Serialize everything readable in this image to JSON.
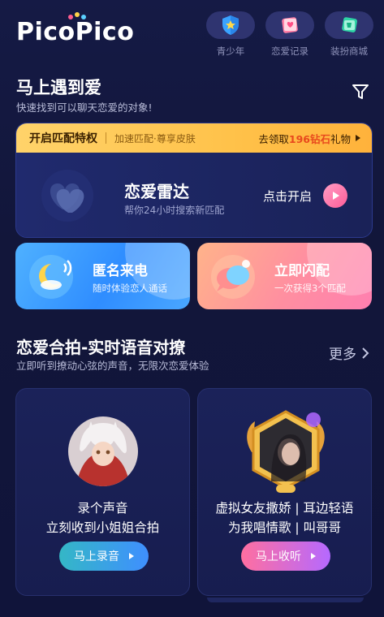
{
  "header": {
    "logo": "PicoPico",
    "nav": [
      {
        "label": "青少年",
        "icon": "shield-star-icon"
      },
      {
        "label": "恋爱记录",
        "icon": "love-record-icon"
      },
      {
        "label": "装扮商城",
        "icon": "dress-up-store-icon"
      }
    ]
  },
  "match": {
    "title": "马上遇到爱",
    "subtitle": "快速找到可以聊天恋爱的对象!",
    "banner": {
      "title": "开启匹配特权",
      "desc": "加速匹配·尊享皮肤",
      "reward_prefix": "去领取",
      "reward_highlight": "196钻石",
      "reward_suffix": "礼物"
    },
    "radar": {
      "title": "恋爱雷达",
      "subtitle": "帮你24小时搜索新匹配",
      "action": "点击开启"
    },
    "tiles": [
      {
        "title": "匿名来电",
        "subtitle": "随时体验恋人通话",
        "icon": "moon-call-icon"
      },
      {
        "title": "立即闪配",
        "subtitle": "一次获得3个匹配",
        "icon": "chat-bubble-icon"
      }
    ]
  },
  "voice": {
    "title": "恋爱合拍-实时语音对撩",
    "subtitle": "立即听到撩动心弦的声音，无限次恋爱体验",
    "more": "更多",
    "cards": [
      {
        "line1": "录个声音",
        "line2": "立刻收到小姐姐合拍",
        "button": "马上录音"
      },
      {
        "line1": "虚拟女友撒娇 | 耳边轻语",
        "line2": "为我唱情歌 | 叫哥哥",
        "button": "马上收听"
      }
    ]
  },
  "colors": {
    "background": "#12163a",
    "banner": "#ffc24a",
    "accent_pink": "#ff5c98",
    "accent_blue": "#2f8dff"
  }
}
